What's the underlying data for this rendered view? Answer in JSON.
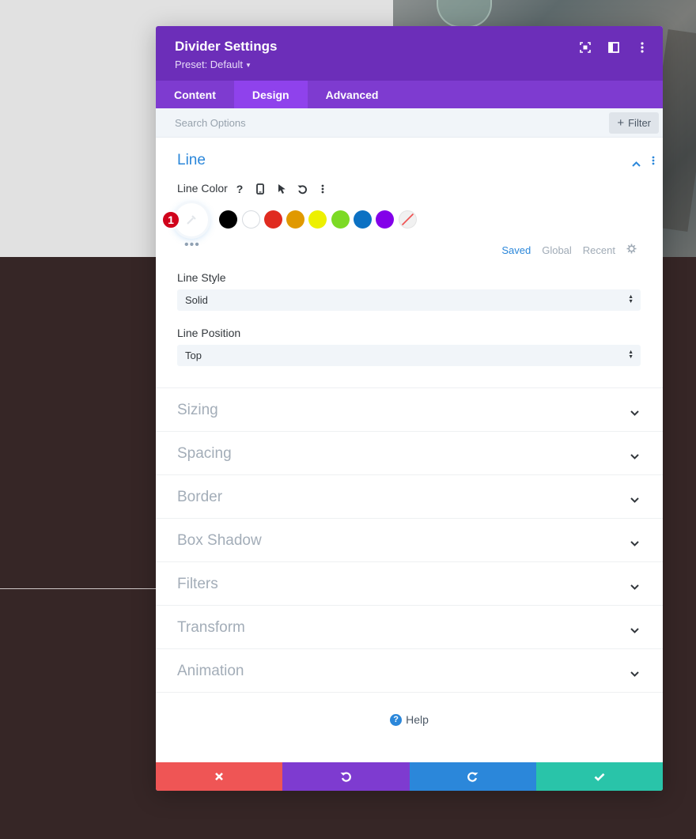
{
  "modal": {
    "title": "Divider Settings",
    "preset": "Preset: Default"
  },
  "tabs": [
    {
      "label": "Content",
      "active": false
    },
    {
      "label": "Design",
      "active": true
    },
    {
      "label": "Advanced",
      "active": false
    }
  ],
  "search": {
    "placeholder": "Search Options",
    "filter_label": "Filter"
  },
  "line_section": {
    "title": "Line",
    "line_color_label": "Line Color",
    "badge": "1",
    "swatches": [
      "#000000",
      "#ffffff",
      "#e02b20",
      "#e09900",
      "#edf000",
      "#7cda24",
      "#0c71c3",
      "#8300e9"
    ],
    "palette_tabs": [
      "Saved",
      "Global",
      "Recent"
    ],
    "line_style_label": "Line Style",
    "line_style_value": "Solid",
    "line_position_label": "Line Position",
    "line_position_value": "Top"
  },
  "sections": [
    "Sizing",
    "Spacing",
    "Border",
    "Box Shadow",
    "Filters",
    "Transform",
    "Animation"
  ],
  "help_label": "Help",
  "colors": {
    "header": "#6c2eb9",
    "tabs": "#7e3bd0",
    "active_tab": "#8f42ec",
    "accent": "#2b87da",
    "cancel": "#ef5555",
    "undo": "#7e3bd0",
    "redo": "#2b87da",
    "save": "#29c4a9"
  }
}
